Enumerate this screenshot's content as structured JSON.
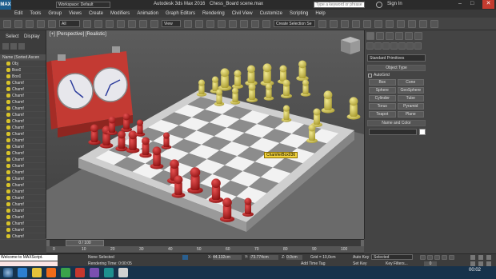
{
  "title_bar": {
    "logo": "MAX",
    "workspace": "Workspace: Default",
    "app_title": "Autodesk 3ds Max 2016",
    "file_name": "Chess_Board scene.max",
    "search_placeholder": "Type a keyword or phrase",
    "sign_in": "Sign In"
  },
  "menu": [
    "Edit",
    "Tools",
    "Group",
    "Views",
    "Create",
    "Modifiers",
    "Animation",
    "Graph Editors",
    "Rendering",
    "Civil View",
    "Customize",
    "Scripting",
    "Help"
  ],
  "toolbar": {
    "filter": "All",
    "view": "View",
    "selection_set": "Create Selection Se"
  },
  "scene_explorer": {
    "tabs": [
      "Select",
      "Display"
    ],
    "header": "Name (Sorted Ascen",
    "items": [
      "Obj",
      "Box0",
      "Box0",
      "Chamf",
      "Chamf",
      "Chamf",
      "Chamf",
      "Chamf",
      "Chamf",
      "Chamf",
      "Chamf",
      "Chamf",
      "Chamf",
      "Chamf",
      "Chamf",
      "Chamf",
      "Chamf",
      "Chamf",
      "Chamf",
      "Chamf",
      "Chamf",
      "Chamf",
      "Chamf",
      "Chamf",
      "Chamf",
      "Chamf",
      "Chamf",
      "Chamf"
    ]
  },
  "viewport": {
    "label": "[+] [Perspective] [Realistic]",
    "tooltip": "ChamferBox036"
  },
  "command_panel": {
    "category": "Standard Primitives",
    "object_type_header": "Object Type",
    "autogrid": "AutoGrid",
    "buttons": [
      "Box",
      "Cone",
      "Sphere",
      "GeoSphere",
      "Cylinder",
      "Tube",
      "Torus",
      "Pyramid",
      "Teapot",
      "Plane"
    ],
    "name_color_header": "Name and Color"
  },
  "timeline": {
    "frame": "0 / 100",
    "ticks": [
      "0",
      "10",
      "20",
      "30",
      "40",
      "50",
      "60",
      "70",
      "80",
      "90",
      "100"
    ]
  },
  "status": {
    "script_text": "Welcome to MAXScript.",
    "selection": "None Selected",
    "render_time": "Rendering Time: 0:00:05",
    "x_label": "X:",
    "x_value": "44.132cm",
    "y_label": "Y:",
    "y_value": "-73.774cm",
    "z_label": "Z:",
    "z_value": "0.0cm",
    "grid": "Grid = 10,0cm",
    "add_time_tag": "Add Time Tag",
    "auto_key": "Auto Key",
    "auto_key_value": "Selected",
    "set_key": "Set Key",
    "key_filters": "Key Filters...",
    "frame_value": "0"
  },
  "taskbar": {
    "clock": "00:02"
  },
  "colors": {
    "red_pieces": "#b82121",
    "yellow_pieces": "#d4c64f",
    "clock_case": "#c33a33",
    "selection_yellow": "#f2d23c"
  }
}
